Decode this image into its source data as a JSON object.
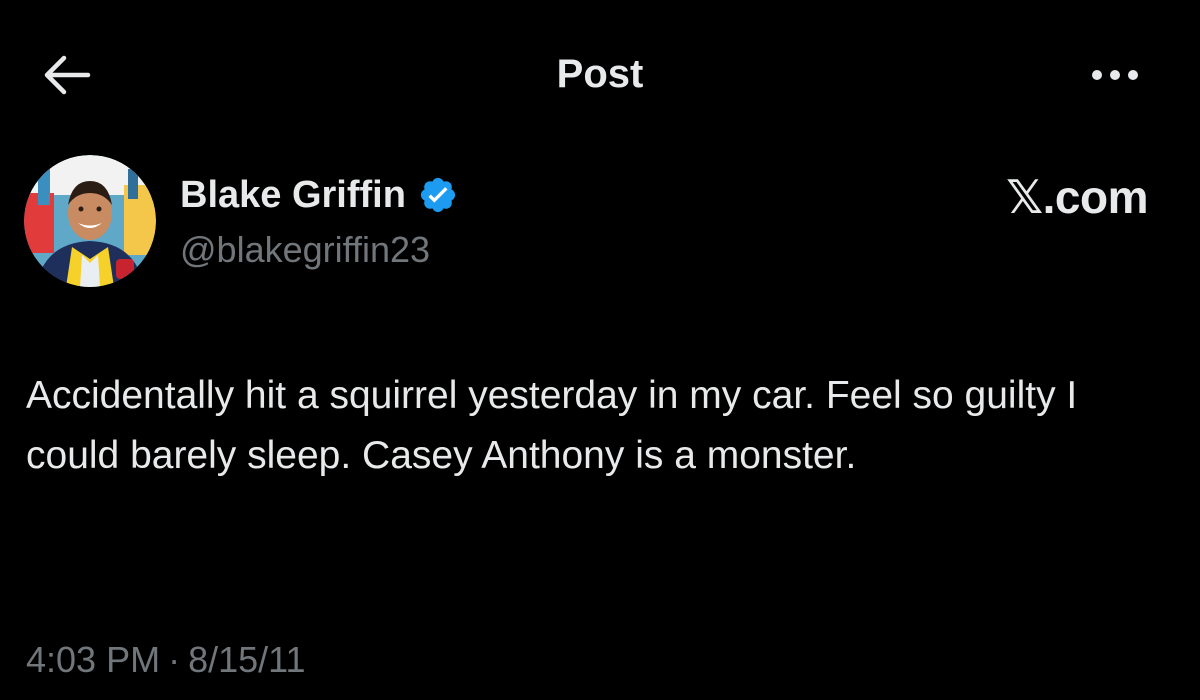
{
  "header": {
    "title": "Post",
    "back_icon": "arrow-left-icon",
    "more_icon": "more-horizontal-icon"
  },
  "author": {
    "display_name": "Blake Griffin",
    "handle": "@blakegriffin23",
    "verified": true,
    "verified_icon": "verified-badge-icon",
    "verified_color": "#1d9bf0"
  },
  "watermark": "𝕏.com",
  "post": {
    "text": "Accidentally hit a squirrel yesterday in my car. Feel so guilty I could barely sleep. Casey Anthony is a monster.",
    "time": "4:03 PM",
    "separator": "·",
    "date": "8/15/11"
  },
  "colors": {
    "background": "#000000",
    "primary_text": "#e7e9ea",
    "secondary_text": "#71767b"
  }
}
